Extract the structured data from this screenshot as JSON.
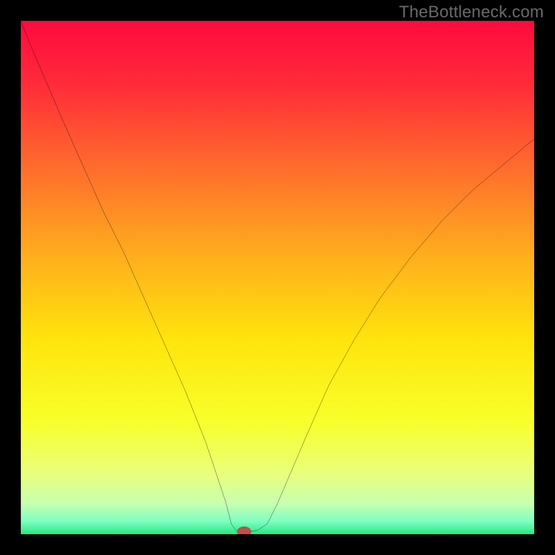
{
  "watermark": "TheBottleneck.com",
  "chart_data": {
    "type": "line",
    "title": "",
    "xlabel": "",
    "ylabel": "",
    "xlim": [
      0,
      100
    ],
    "ylim": [
      0,
      100
    ],
    "annotations": [],
    "background": {
      "type": "vertical-gradient",
      "stops": [
        {
          "pos": 0.0,
          "color": "#ff0a3f"
        },
        {
          "pos": 0.12,
          "color": "#ff2a3a"
        },
        {
          "pos": 0.28,
          "color": "#ff6a2d"
        },
        {
          "pos": 0.45,
          "color": "#ffab1e"
        },
        {
          "pos": 0.62,
          "color": "#ffe40c"
        },
        {
          "pos": 0.78,
          "color": "#f8ff2a"
        },
        {
          "pos": 0.88,
          "color": "#eaff7a"
        },
        {
          "pos": 0.94,
          "color": "#c7ffb0"
        },
        {
          "pos": 0.975,
          "color": "#7dffc2"
        },
        {
          "pos": 1.0,
          "color": "#27e97f"
        }
      ]
    },
    "series": [
      {
        "name": "bottleneck-curve",
        "color": "#000000",
        "x": [
          0,
          2,
          5,
          8,
          12,
          16,
          20,
          24,
          28,
          32,
          36,
          38,
          40,
          41,
          42,
          43,
          44,
          45,
          46,
          48,
          50,
          53,
          56,
          60,
          65,
          70,
          76,
          82,
          88,
          94,
          100
        ],
        "y": [
          100,
          95,
          88,
          81,
          72,
          63,
          55,
          46,
          37,
          28,
          18,
          12,
          6,
          2,
          0.6,
          0.5,
          0.5,
          0.6,
          0.7,
          2,
          6,
          13,
          20,
          29,
          38,
          46,
          54,
          61,
          67,
          72,
          77
        ]
      }
    ],
    "marker": {
      "name": "optimal-point",
      "x": 43.5,
      "y": 0.5,
      "rx": 1.4,
      "ry": 1.0,
      "color": "#c14f4a"
    }
  }
}
